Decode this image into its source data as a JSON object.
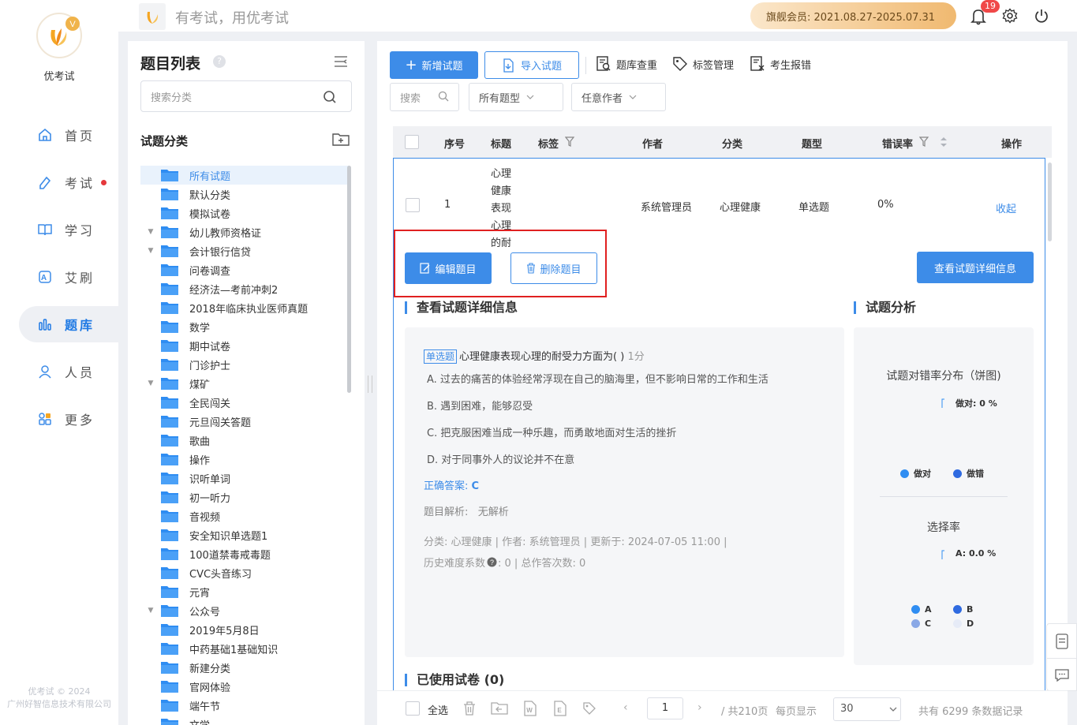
{
  "app": {
    "name": "优考试",
    "slogan": "有考试，用优考试",
    "copyright_line1": "优考试 © 2024",
    "copyright_line2": "广州好智信息技术有限公司"
  },
  "nav": {
    "items": [
      {
        "label": "首页",
        "icon": "home-icon"
      },
      {
        "label": "考试",
        "icon": "exam-icon",
        "dot": true
      },
      {
        "label": "学习",
        "icon": "book-icon"
      },
      {
        "label": "艾刷",
        "icon": "practice-icon"
      },
      {
        "label": "题库",
        "icon": "question-bank-icon",
        "active": true
      },
      {
        "label": "人员",
        "icon": "user-icon"
      },
      {
        "label": "更多",
        "icon": "more-icon"
      }
    ]
  },
  "topbar": {
    "member_label": "旗舰会员:  2021.08.27-2025.07.31",
    "notification_count": "19"
  },
  "tree": {
    "title": "题目列表",
    "help": "?",
    "search_placeholder": "搜索分类",
    "category_title": "试题分类",
    "nodes": [
      {
        "label": "所有试题",
        "selected": true,
        "arrow": false
      },
      {
        "label": "默认分类",
        "arrow": false
      },
      {
        "label": "模拟试卷",
        "arrow": false
      },
      {
        "label": "幼儿教师资格证",
        "arrow": true
      },
      {
        "label": "会计银行信贷",
        "arrow": true
      },
      {
        "label": "问卷调查",
        "arrow": false
      },
      {
        "label": "经济法—考前冲刺2",
        "arrow": false
      },
      {
        "label": "2018年临床执业医师真题",
        "arrow": false
      },
      {
        "label": "数学",
        "arrow": false
      },
      {
        "label": "期中试卷",
        "arrow": false
      },
      {
        "label": "门诊护士",
        "arrow": false
      },
      {
        "label": "煤矿",
        "arrow": true
      },
      {
        "label": "全民闯关",
        "arrow": false
      },
      {
        "label": "元旦闯关答题",
        "arrow": false
      },
      {
        "label": "歌曲",
        "arrow": false
      },
      {
        "label": "操作",
        "arrow": false
      },
      {
        "label": "识听单词",
        "arrow": false
      },
      {
        "label": "初一听力",
        "arrow": false
      },
      {
        "label": "音视频",
        "arrow": false
      },
      {
        "label": "安全知识单选题1",
        "arrow": false
      },
      {
        "label": "100道禁毒戒毒题",
        "arrow": false
      },
      {
        "label": "CVC头音练习",
        "arrow": false
      },
      {
        "label": "元宵",
        "arrow": false
      },
      {
        "label": "公众号",
        "arrow": true
      },
      {
        "label": "2019年5月8日",
        "arrow": false
      },
      {
        "label": "中药基础1基础知识",
        "arrow": false
      },
      {
        "label": "新建分类",
        "arrow": false
      },
      {
        "label": "官网体验",
        "arrow": false
      },
      {
        "label": "端午节",
        "arrow": false
      },
      {
        "label": "文学",
        "arrow": false
      }
    ]
  },
  "toolbar": {
    "add_label": "新增试题",
    "import_label": "导入试题",
    "dup_check_label": "题库查重",
    "tag_manage_label": "标签管理",
    "report_label": "考生报错",
    "search_placeholder": "搜索",
    "type_filter": "所有题型",
    "author_filter": "任意作者"
  },
  "table": {
    "headers": {
      "index": "序号",
      "title": "标题",
      "tags": "标签",
      "author": "作者",
      "category": "分类",
      "type": "题型",
      "error_rate": "错误率",
      "actions": "操作"
    },
    "row": {
      "index": "1",
      "title": "心理健康表现心理的耐",
      "author": "系统管理员",
      "category": "心理健康",
      "type": "单选题",
      "error_rate": "0%",
      "collapse_label": "收起"
    }
  },
  "detail": {
    "edit_label": "编辑题目",
    "delete_label": "删除题目",
    "view_detail_label": "查看试题详细信息",
    "section_title": "查看试题详细信息",
    "analysis_title": "试题分析",
    "question_type_tag": "单选题",
    "question_text": "心理健康表现心理的耐受力方面为( )",
    "score": "1分",
    "options": [
      "A. 过去的痛苦的体验经常浮现在自己的脑海里，但不影响日常的工作和生活",
      "B. 遇到困难，能够忍受",
      "C. 把克服困难当成一种乐趣，而勇敢地面对生活的挫折",
      "D. 对于同事外人的议论并不在意"
    ],
    "answer_label": "正确答案:",
    "answer_value": "C",
    "explain_label": "题目解析:",
    "explain_value": "无解析",
    "meta_line1": "分类:  心理健康  |  作者:  系统管理员  |  更新于:  2024-07-05 11:00  |",
    "difficulty_label": "历史难度系数",
    "difficulty_rest": ":  0  |  总作答次数:  0",
    "used_papers": "已使用试卷   (0)"
  },
  "analysis": {
    "pie1_title": "试题对错率分布（饼图)",
    "pie1_label": "做对: 0 %",
    "pie1_legend": [
      {
        "label": "做对",
        "color": "#2f8df2"
      },
      {
        "label": "做错",
        "color": "#2f6ae0"
      }
    ],
    "pie2_title": "选择率",
    "pie2_label": "A: 0.0 %",
    "pie2_legend": [
      {
        "label": "A",
        "color": "#2f8df2"
      },
      {
        "label": "B",
        "color": "#2f6ae0"
      },
      {
        "label": "C",
        "color": "#8aa8e6"
      },
      {
        "label": "D",
        "color": "#e6ebf7"
      }
    ]
  },
  "footer": {
    "select_all": "全选",
    "page": "1",
    "total_pages": "/ 共210页",
    "per_page_label": "每页显示",
    "per_page_value": "30",
    "total_records": "共有 6299 条数据记录"
  }
}
